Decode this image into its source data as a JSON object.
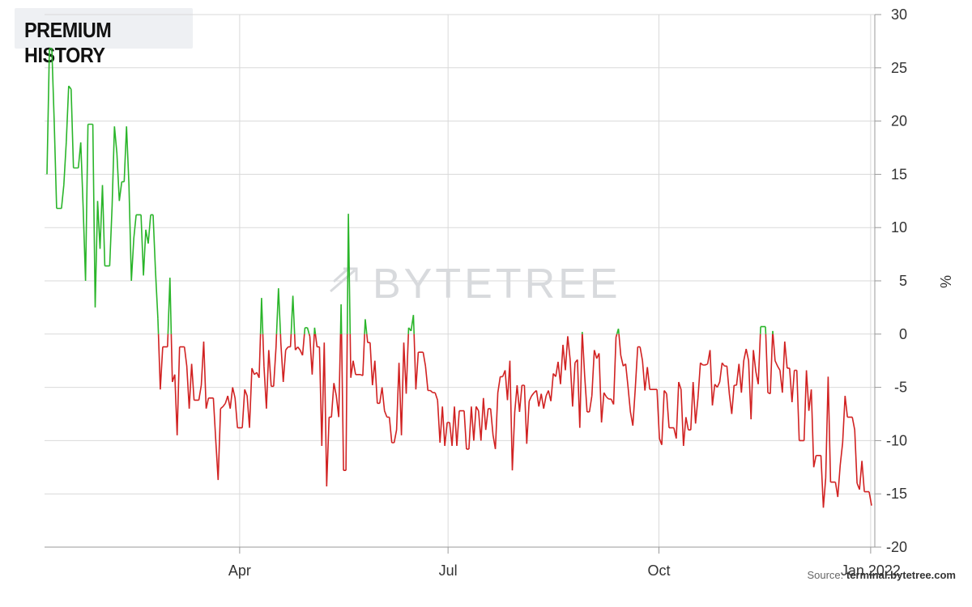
{
  "title": "PREMIUM HISTORY",
  "watermark": "BYTETREE",
  "source_label": "Source:",
  "source_site": "terminal.bytetree.com",
  "chart_data": {
    "type": "line",
    "ylabel": "%",
    "ylim": [
      -20,
      30
    ],
    "y_ticks": [
      30,
      25,
      20,
      15,
      10,
      5,
      0,
      -5,
      -10,
      -15,
      -20
    ],
    "x_ticks": [
      {
        "label": "Apr",
        "x": 0.235
      },
      {
        "label": "Jul",
        "x": 0.486
      },
      {
        "label": "Oct",
        "x": 0.74
      },
      {
        "label": "Jan 2022",
        "x": 0.995
      }
    ],
    "grid": true,
    "colors": {
      "positive": "#2ab52a",
      "negative": "#d12222",
      "grid": "#d9d9d9",
      "axis": "#9a9a9a"
    },
    "series": [
      {
        "values": [
          15.0,
          26.8,
          26.8,
          20.0,
          11.8,
          11.8,
          11.8,
          14.0,
          18.0,
          23.3,
          23.0,
          15.6,
          15.6,
          15.6,
          18.0,
          12.0,
          5.0,
          19.7,
          19.7,
          19.7,
          2.5,
          12.5,
          8.0,
          14.0,
          6.4,
          6.4,
          6.4,
          12.0,
          19.5,
          17.0,
          12.5,
          14.3,
          14.3,
          19.5,
          14.0,
          5.0,
          9.0,
          11.2,
          11.2,
          11.2,
          5.5,
          9.8,
          8.5,
          11.2,
          11.2,
          6.0,
          1.5,
          -5.2,
          -1.2,
          -1.2,
          -1.2,
          5.3,
          -4.5,
          -3.8,
          -9.5,
          -1.2,
          -1.2,
          -1.2,
          -3.0,
          -7.0,
          -2.8,
          -6.2,
          -6.2,
          -6.2,
          -4.8,
          -0.7,
          -7.0,
          -6.0,
          -6.0,
          -6.0,
          -10.0,
          -13.7,
          -7.0,
          -6.8,
          -6.5,
          -5.8,
          -7.0,
          -5.0,
          -6.0,
          -8.8,
          -8.8,
          -8.8,
          -5.2,
          -5.8,
          -8.8,
          -3.2,
          -3.8,
          -3.6,
          -4.1,
          3.4,
          -3.0,
          -7.0,
          -1.5,
          -4.9,
          -4.9,
          -1.2,
          4.3,
          -0.8,
          -4.5,
          -1.5,
          -1.2,
          -1.2,
          3.6,
          -1.5,
          -1.2,
          -1.5,
          -2.0,
          0.6,
          0.6,
          -0.2,
          -3.8,
          0.6,
          -1.2,
          -1.2,
          -10.5,
          -0.8,
          -14.3,
          -7.8,
          -7.8,
          -4.6,
          -5.8,
          -7.8,
          2.8,
          -12.8,
          -12.8,
          11.3,
          -4.1,
          -2.5,
          -3.8,
          -3.8,
          -3.8,
          -3.9,
          1.4,
          -0.8,
          -0.8,
          -4.8,
          -2.5,
          -6.5,
          -6.5,
          -5.0,
          -7.2,
          -7.8,
          -7.8,
          -10.2,
          -10.2,
          -9.0,
          -2.7,
          -9.5,
          -0.8,
          -5.6,
          0.6,
          0.3,
          1.8,
          -5.2,
          -1.7,
          -1.7,
          -1.7,
          -3.0,
          -5.3,
          -5.3,
          -5.5,
          -5.5,
          -6.2,
          -10.2,
          -6.8,
          -10.5,
          -8.3,
          -8.3,
          -10.5,
          -6.8,
          -10.5,
          -7.2,
          -7.2,
          -7.2,
          -10.8,
          -10.8,
          -6.8,
          -10.0,
          -6.8,
          -7.2,
          -10.0,
          -6.0,
          -9.0,
          -7.0,
          -7.0,
          -9.5,
          -10.8,
          -5.5,
          -4.0,
          -4.0,
          -3.4,
          -6.2,
          -2.5,
          -12.8,
          -7.3,
          -4.8,
          -7.3,
          -4.8,
          -4.8,
          -10.3,
          -6.3,
          -5.8,
          -5.5,
          -5.3,
          -6.8,
          -5.6,
          -7.0,
          -5.8,
          -5.3,
          -6.3,
          -3.7,
          -4.0,
          -2.6,
          -4.7,
          -1.0,
          -3.4,
          -0.2,
          -2.4,
          -6.8,
          -2.7,
          -2.4,
          -8.8,
          0.2,
          -3.9,
          -7.3,
          -7.3,
          -5.8,
          -1.5,
          -2.3,
          -1.8,
          -8.3,
          -5.5,
          -5.9,
          -6.1,
          -6.1,
          -6.6,
          -0.3,
          0.5,
          -2.0,
          -3.0,
          -2.8,
          -5.0,
          -7.3,
          -8.6,
          -5.1,
          -1.2,
          -1.2,
          -2.5,
          -5.3,
          -3.1,
          -5.2,
          -5.2,
          -5.2,
          -5.2,
          -9.8,
          -10.4,
          -5.3,
          -5.6,
          -8.8,
          -8.8,
          -8.8,
          -9.8,
          -4.5,
          -5.2,
          -10.5,
          -7.8,
          -9.0,
          -9.0,
          -4.5,
          -8.4,
          -6.0,
          -2.7,
          -2.9,
          -2.9,
          -2.8,
          -1.5,
          -6.7,
          -4.7,
          -5.0,
          -4.5,
          -2.7,
          -3.0,
          -3.0,
          -5.6,
          -7.5,
          -4.8,
          -4.8,
          -2.8,
          -5.5,
          -2.5,
          -1.4,
          -2.5,
          -8.0,
          -1.5,
          -3.5,
          -4.7,
          0.7,
          0.7,
          0.7,
          -5.5,
          -5.6,
          0.3,
          -2.5,
          -3.0,
          -3.4,
          -5.5,
          -0.7,
          -3.2,
          -3.2,
          -6.4,
          -3.4,
          -3.4,
          -10.0,
          -10.0,
          -10.0,
          -3.4,
          -7.2,
          -5.2,
          -12.5,
          -11.4,
          -11.4,
          -11.4,
          -16.3,
          -13.5,
          -4.0,
          -13.9,
          -13.9,
          -13.9,
          -15.3,
          -12.3,
          -10.2,
          -5.8,
          -7.8,
          -7.8,
          -7.8,
          -9.0,
          -14.0,
          -14.6,
          -11.9,
          -14.8,
          -14.8,
          -14.8,
          -16.1
        ]
      }
    ]
  }
}
